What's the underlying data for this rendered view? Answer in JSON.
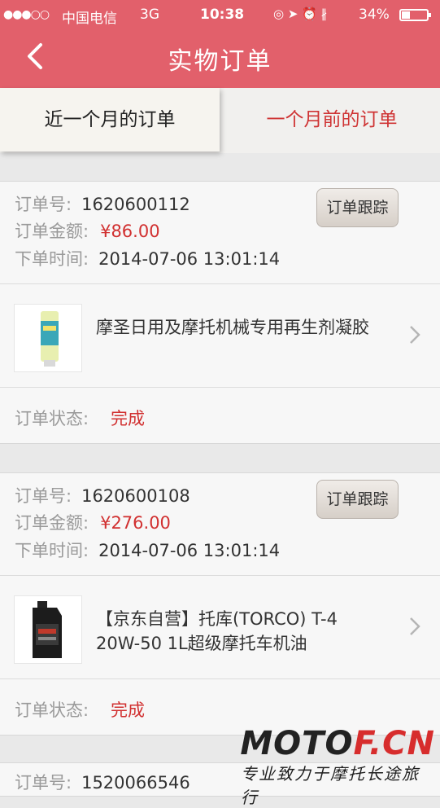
{
  "status_bar": {
    "signal": "●●●○○",
    "carrier": "中国电信",
    "network": "3G",
    "time": "10:38",
    "icons": "◎ ➤ ⏰ ∦",
    "battery": "34%"
  },
  "nav": {
    "title": "实物订单",
    "back_icon": "chevron-left-icon"
  },
  "tabs": [
    {
      "label": "近一个月的订单",
      "selected": true
    },
    {
      "label": "一个月前的订单",
      "selected": false
    }
  ],
  "labels": {
    "order_no": "订单号:",
    "amount": "订单金额:",
    "time": "下单时间:",
    "status": "订单状态:",
    "track_button": "订单跟踪"
  },
  "orders": [
    {
      "order_no": "1620600112",
      "amount": "¥86.00",
      "time": "2014-07-06 13:01:14",
      "product": "摩圣日用及摩托机械专用再生剂凝胶",
      "status": "完成"
    },
    {
      "order_no": "1620600108",
      "amount": "¥276.00",
      "time": "2014-07-06 13:01:14",
      "product": "【京东自营】托库(TORCO) T-4 20W-50 1L超级摩托车机油",
      "status": "完成"
    },
    {
      "order_no": "1520066546"
    }
  ],
  "watermark": {
    "logo_a": "MOTO",
    "logo_b": "F.CN",
    "tagline": "专业致力于摩托长途旅行"
  },
  "colors": {
    "brand": "#e2606b",
    "accent_red": "#d13030"
  }
}
